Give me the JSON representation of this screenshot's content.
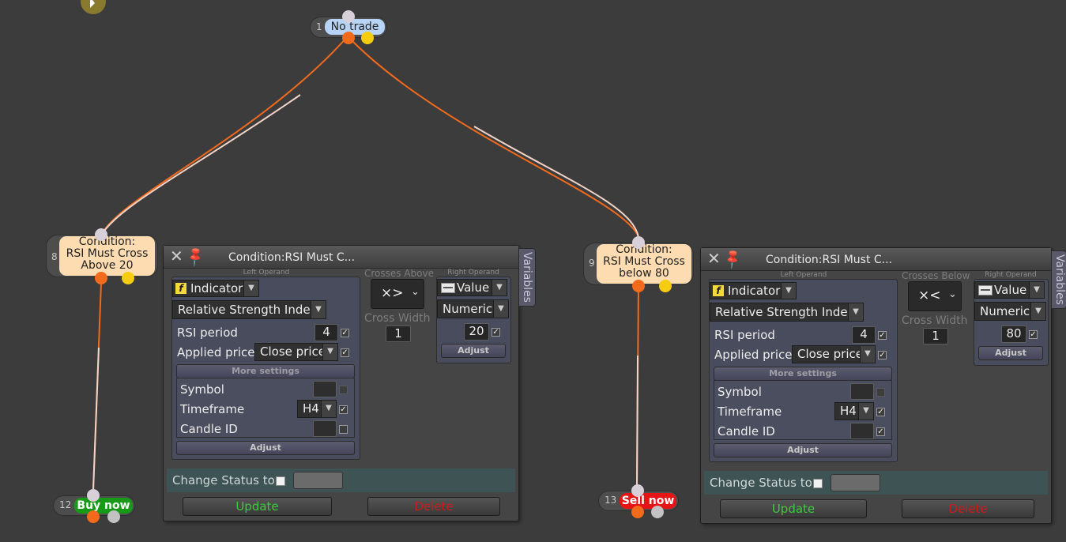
{
  "nodes": {
    "root": {
      "num": "1",
      "label": "No trade",
      "color": "#b7d3f5"
    },
    "cond1": {
      "num": "8",
      "line1": "Condition:",
      "line2": "RSI Must Cross",
      "line3": "Above 20",
      "color": "#fcdcb0"
    },
    "cond2": {
      "num": "9",
      "line1": "Condition:",
      "line2": "RSI Must Cross",
      "line3": "below 80",
      "color": "#fcdcb0"
    },
    "buy": {
      "num": "12",
      "label": "Buy now",
      "color": "#179a17"
    },
    "sell": {
      "num": "13",
      "label": "Sell now",
      "color": "#e61414"
    }
  },
  "icons": {
    "close": "✕",
    "pin": "📌",
    "dropdown": "▼",
    "check": "✓",
    "function": "f"
  },
  "panel1": {
    "title": "Condition:RSI Must C...",
    "variables_tab": "Variables",
    "left_operand_caption": "Left Operand",
    "operand_type": "Indicator",
    "indicator_name": "Relative Strength Index",
    "rsi_period_label": "RSI period",
    "rsi_period_value": "4",
    "applied_price_label": "Applied price",
    "applied_price_value": "Close price",
    "more_settings": "More settings",
    "symbol_label": "Symbol",
    "timeframe_label": "Timeframe",
    "timeframe_value": "H4",
    "candle_id_label": "Candle ID",
    "adjust_label": "Adjust",
    "operator_caption": "Crosses Above",
    "operator_symbol": "×>",
    "cross_width_label": "Cross Width",
    "cross_width_value": "1",
    "right_operand_caption": "Right Operand",
    "right_type": "Value",
    "right_subtype": "Numeric",
    "right_value": "20",
    "right_adjust": "Adjust",
    "change_status_label": "Change Status to",
    "update_label": "Update",
    "delete_label": "Delete"
  },
  "panel2": {
    "title": "Condition:RSI Must C...",
    "variables_tab": "Variables",
    "left_operand_caption": "Left Operand",
    "operand_type": "Indicator",
    "indicator_name": "Relative Strength Index",
    "rsi_period_label": "RSI period",
    "rsi_period_value": "4",
    "applied_price_label": "Applied price",
    "applied_price_value": "Close price",
    "more_settings": "More settings",
    "symbol_label": "Symbol",
    "timeframe_label": "Timeframe",
    "timeframe_value": "H4",
    "candle_id_label": "Candle ID",
    "adjust_label": "Adjust",
    "operator_caption": "Crosses Below",
    "operator_symbol": "×<",
    "cross_width_label": "Cross Width",
    "cross_width_value": "1",
    "right_operand_caption": "Right Operand",
    "right_type": "Value",
    "right_subtype": "Numeric",
    "right_value": "80",
    "right_adjust": "Adjust",
    "change_status_label": "Change Status to",
    "update_label": "Update",
    "delete_label": "Delete"
  },
  "colors": {
    "update": "#3ecb3e",
    "delete": "#cc1b1b",
    "link_orange": "#f26b1d"
  }
}
